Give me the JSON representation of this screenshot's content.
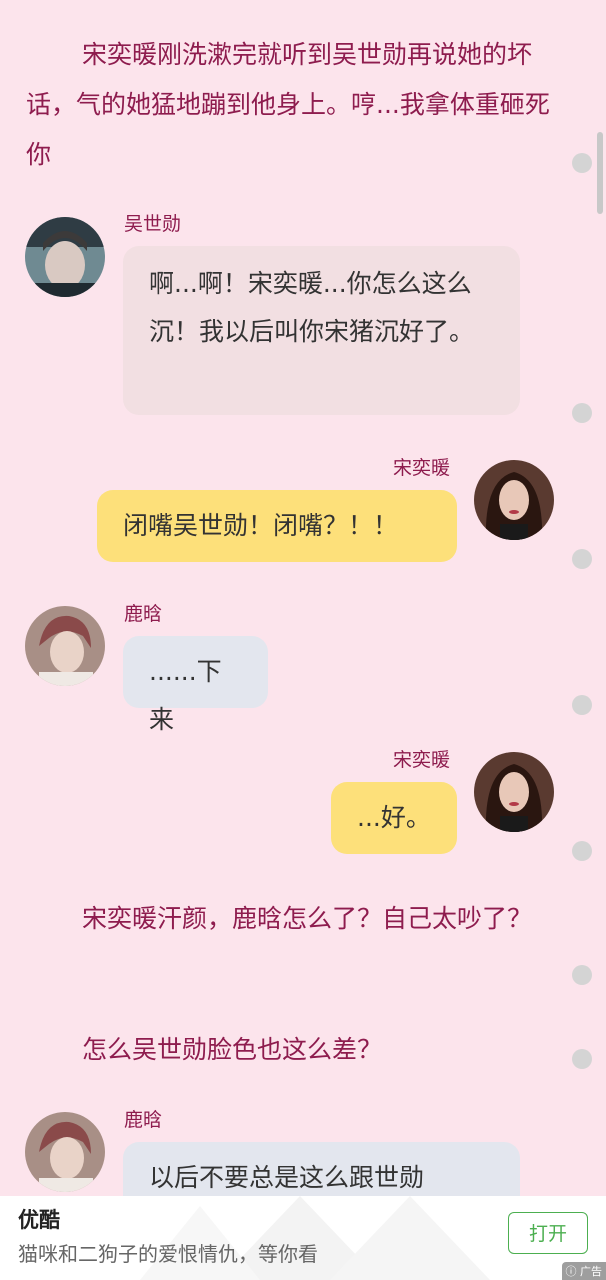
{
  "story": {
    "narration_1": "宋奕暖刚洗漱完就听到吴世勋再说她的坏话，气的她猛地蹦到他身上。哼...我拿体重砸死你",
    "narration_2": "宋奕暖汗颜，鹿晗怎么了？自己太吵了？",
    "narration_3": "怎么吴世勋脸色也这么差？"
  },
  "messages": [
    {
      "speaker": "吴世勋",
      "text": "啊...啊！宋奕暖...你怎么这么沉！我以后叫你宋猪沉好了。"
    },
    {
      "speaker": "宋奕暖",
      "text": "闭嘴吴世勋！闭嘴？！！"
    },
    {
      "speaker": "鹿晗",
      "text": "......下来"
    },
    {
      "speaker": "宋奕暖",
      "text": "...好。"
    },
    {
      "speaker": "鹿晗",
      "text": "以后不要总是这么跟世勋"
    }
  ],
  "ad": {
    "title": "优酷",
    "description": "猫咪和二狗子的爱恨情仇，等你看",
    "button": "打开",
    "tag": "广告"
  },
  "colors": {
    "background": "#fce4ec",
    "narration_text": "#8e1c4e",
    "bubble_left": "#f2dfe2",
    "bubble_blue": "#e3e6ee",
    "bubble_right": "#fde07a",
    "ad_button": "#4caf50"
  }
}
